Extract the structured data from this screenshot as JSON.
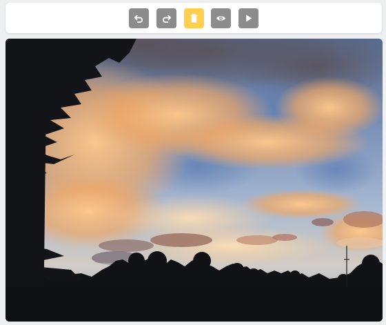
{
  "toolbar": {
    "buttons": [
      {
        "id": "undo",
        "icon": "undo-icon",
        "active": false
      },
      {
        "id": "redo",
        "icon": "redo-icon",
        "active": false
      },
      {
        "id": "delete",
        "icon": "trash-icon",
        "active": true
      },
      {
        "id": "preview",
        "icon": "eye-icon",
        "active": false
      },
      {
        "id": "play",
        "icon": "play-icon",
        "active": false
      }
    ],
    "colors": {
      "default": "#8c8c8c",
      "active": "#ffd04f",
      "icon": "#ffffff"
    }
  },
  "canvas": {
    "image": "sunset-sky-photo",
    "colors": {
      "sky_top": "#5d6f93",
      "sky_mid": "#8fa6c9",
      "sky_low": "#d9c7b8",
      "cloud_glow": "#f5b777",
      "cloud_shadow": "#6f6670",
      "silhouette": "#111316"
    }
  }
}
